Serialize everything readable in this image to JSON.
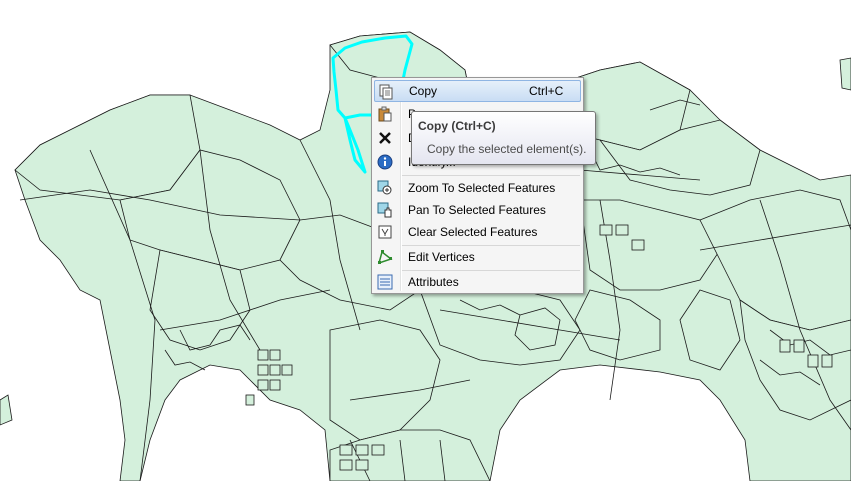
{
  "menu": {
    "items": [
      {
        "label": "Copy",
        "shortcut": "Ctrl+C",
        "icon": "copy-icon"
      },
      {
        "label": "P",
        "shortcut": "",
        "icon": "paste-icon"
      },
      {
        "label": "D",
        "shortcut": "",
        "icon": "delete-icon"
      },
      {
        "label": "Identify...",
        "shortcut": "",
        "icon": "identify-icon"
      },
      {
        "label": "Zoom To Selected Features",
        "shortcut": "",
        "icon": "zoom-to-selected-icon"
      },
      {
        "label": "Pan To Selected Features",
        "shortcut": "",
        "icon": "pan-to-selected-icon"
      },
      {
        "label": "Clear Selected Features",
        "shortcut": "",
        "icon": "clear-selection-icon"
      },
      {
        "label": "Edit Vertices",
        "shortcut": "",
        "icon": "edit-vertices-icon"
      },
      {
        "label": "Attributes",
        "shortcut": "",
        "icon": "attributes-icon"
      }
    ]
  },
  "tooltip": {
    "title": "Copy (Ctrl+C)",
    "body": "Copy the selected element(s)."
  },
  "colors": {
    "parcel_fill": "#d4f0dc",
    "selection": "#00ffff",
    "menu_hover": "#c9ddf4"
  }
}
